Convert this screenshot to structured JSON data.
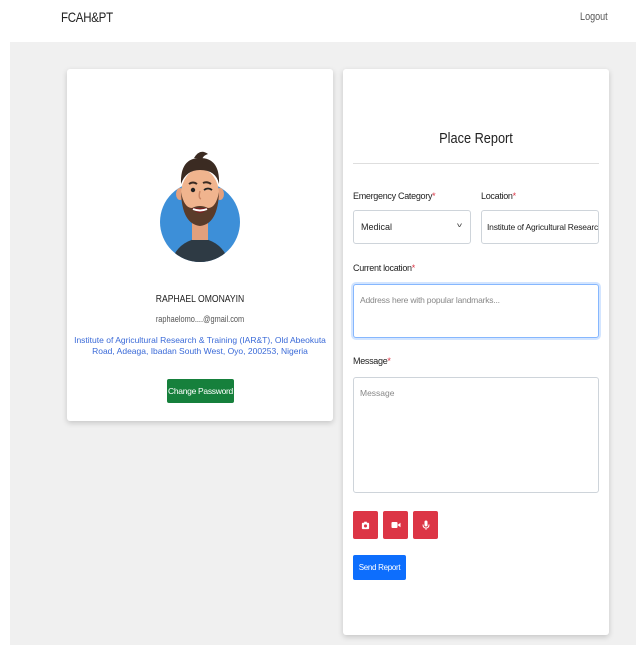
{
  "navbar": {
    "brand": "FCAH&PT",
    "logout_label": "Logout"
  },
  "profile": {
    "name": "RAPHAEL OMONAYIN",
    "email": "raphaelomo....@gmail.com",
    "address": "Institute of Agricultural Research & Training (IAR&T), Old Abeokuta Road, Adeaga, Ibadan South West, Oyo, 200253, Nigeria",
    "change_password_label": "Change Password",
    "avatar_icon": "user-avatar-illustration"
  },
  "report": {
    "title": "Place Report",
    "emergency_category": {
      "label": "Emergency Category",
      "required_mark": "*",
      "selected": "Medical"
    },
    "location": {
      "label": "Location",
      "required_mark": "*",
      "value": "Institute of Agricultural Research & T"
    },
    "current_location": {
      "label": "Current location",
      "required_mark": "*",
      "placeholder": "Address here with popular landmarks..."
    },
    "message": {
      "label": "Message",
      "required_mark": "*",
      "placeholder": "Message"
    },
    "media_buttons": [
      {
        "icon": "camera-icon"
      },
      {
        "icon": "video-icon"
      },
      {
        "icon": "microphone-icon"
      }
    ],
    "send_label": "Send Report"
  },
  "colors": {
    "background": "#f0f0f0",
    "green_button": "#16803c",
    "red_button": "#dc3545",
    "blue_button": "#0d6efd",
    "link_blue": "#3a6ad8"
  }
}
